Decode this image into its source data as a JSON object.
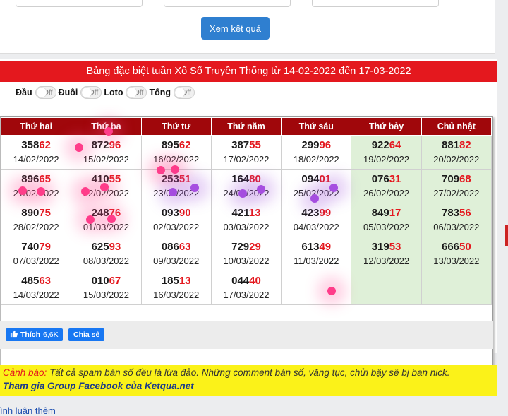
{
  "form": {
    "submit_label": "Xem kết quả"
  },
  "title": "Bảng đặc biệt tuần Xổ Số Truyền Thống từ 14-02-2022 đến 17-03-2022",
  "toggles": [
    {
      "label": "Đầu",
      "state": "Off"
    },
    {
      "label": "Đuôi",
      "state": "Off"
    },
    {
      "label": "Loto",
      "state": "Off"
    },
    {
      "label": "Tổng",
      "state": "Off"
    }
  ],
  "headers": [
    "Thứ hai",
    "Thứ ba",
    "Thứ tư",
    "Thứ năm",
    "Thứ sáu",
    "Thứ bảy",
    "Chủ nhật"
  ],
  "rows": [
    [
      {
        "p": "358",
        "s": "62",
        "d": "14/02/2022"
      },
      {
        "p": "872",
        "s": "96",
        "d": "15/02/2022"
      },
      {
        "p": "895",
        "s": "62",
        "d": "16/02/2022"
      },
      {
        "p": "387",
        "s": "55",
        "d": "17/02/2022"
      },
      {
        "p": "299",
        "s": "96",
        "d": "18/02/2022"
      },
      {
        "p": "922",
        "s": "64",
        "d": "19/02/2022"
      },
      {
        "p": "881",
        "s": "82",
        "d": "20/02/2022"
      }
    ],
    [
      {
        "p": "896",
        "s": "65",
        "d": "21/02/2022"
      },
      {
        "p": "410",
        "s": "55",
        "d": "22/02/2022"
      },
      {
        "p": "253",
        "s": "51",
        "d": "23/02/2022"
      },
      {
        "p": "164",
        "s": "80",
        "d": "24/02/2022"
      },
      {
        "p": "094",
        "s": "01",
        "d": "25/02/2022"
      },
      {
        "p": "076",
        "s": "31",
        "d": "26/02/2022"
      },
      {
        "p": "709",
        "s": "68",
        "d": "27/02/2022"
      }
    ],
    [
      {
        "p": "890",
        "s": "75",
        "d": "28/02/2022"
      },
      {
        "p": "248",
        "s": "76",
        "d": "01/03/2022"
      },
      {
        "p": "093",
        "s": "90",
        "d": "02/03/2022"
      },
      {
        "p": "421",
        "s": "13",
        "d": "03/03/2022"
      },
      {
        "p": "423",
        "s": "99",
        "d": "04/03/2022"
      },
      {
        "p": "849",
        "s": "17",
        "d": "05/03/2022"
      },
      {
        "p": "783",
        "s": "56",
        "d": "06/03/2022"
      }
    ],
    [
      {
        "p": "740",
        "s": "79",
        "d": "07/03/2022"
      },
      {
        "p": "625",
        "s": "93",
        "d": "08/03/2022"
      },
      {
        "p": "086",
        "s": "63",
        "d": "09/03/2022"
      },
      {
        "p": "729",
        "s": "29",
        "d": "10/03/2022"
      },
      {
        "p": "613",
        "s": "49",
        "d": "11/03/2022"
      },
      {
        "p": "319",
        "s": "53",
        "d": "12/03/2022"
      },
      {
        "p": "666",
        "s": "50",
        "d": "13/03/2022"
      }
    ],
    [
      {
        "p": "485",
        "s": "63",
        "d": "14/03/2022"
      },
      {
        "p": "010",
        "s": "67",
        "d": "15/03/2022"
      },
      {
        "p": "185",
        "s": "13",
        "d": "16/03/2022"
      },
      {
        "p": "044",
        "s": "40",
        "d": "17/03/2022"
      },
      {
        "p": "",
        "s": "",
        "d": ""
      },
      {
        "p": "",
        "s": "",
        "d": ""
      },
      {
        "p": "",
        "s": "",
        "d": ""
      }
    ]
  ],
  "social": {
    "like_label": "Thích",
    "like_count": "6,6K",
    "share_label": "Chia sẻ"
  },
  "warning": {
    "label": "Cảnh báo:",
    "text": " Tất cả spam bán số đều là lừa đảo. Những comment bán số, văng tục, chửi bậy sẽ bị ban nick.",
    "group_link": "Tham gia Group Facebook của Ketqua.net"
  },
  "more_link": "ình luận thêm",
  "colors": {
    "title_bg": "#e4181e",
    "header_bg": "#a0070b",
    "weekend_bg": "#dff0d8",
    "highlight": "#e4181e",
    "button": "#2f7fd0",
    "warning_bg": "#fbf219"
  }
}
